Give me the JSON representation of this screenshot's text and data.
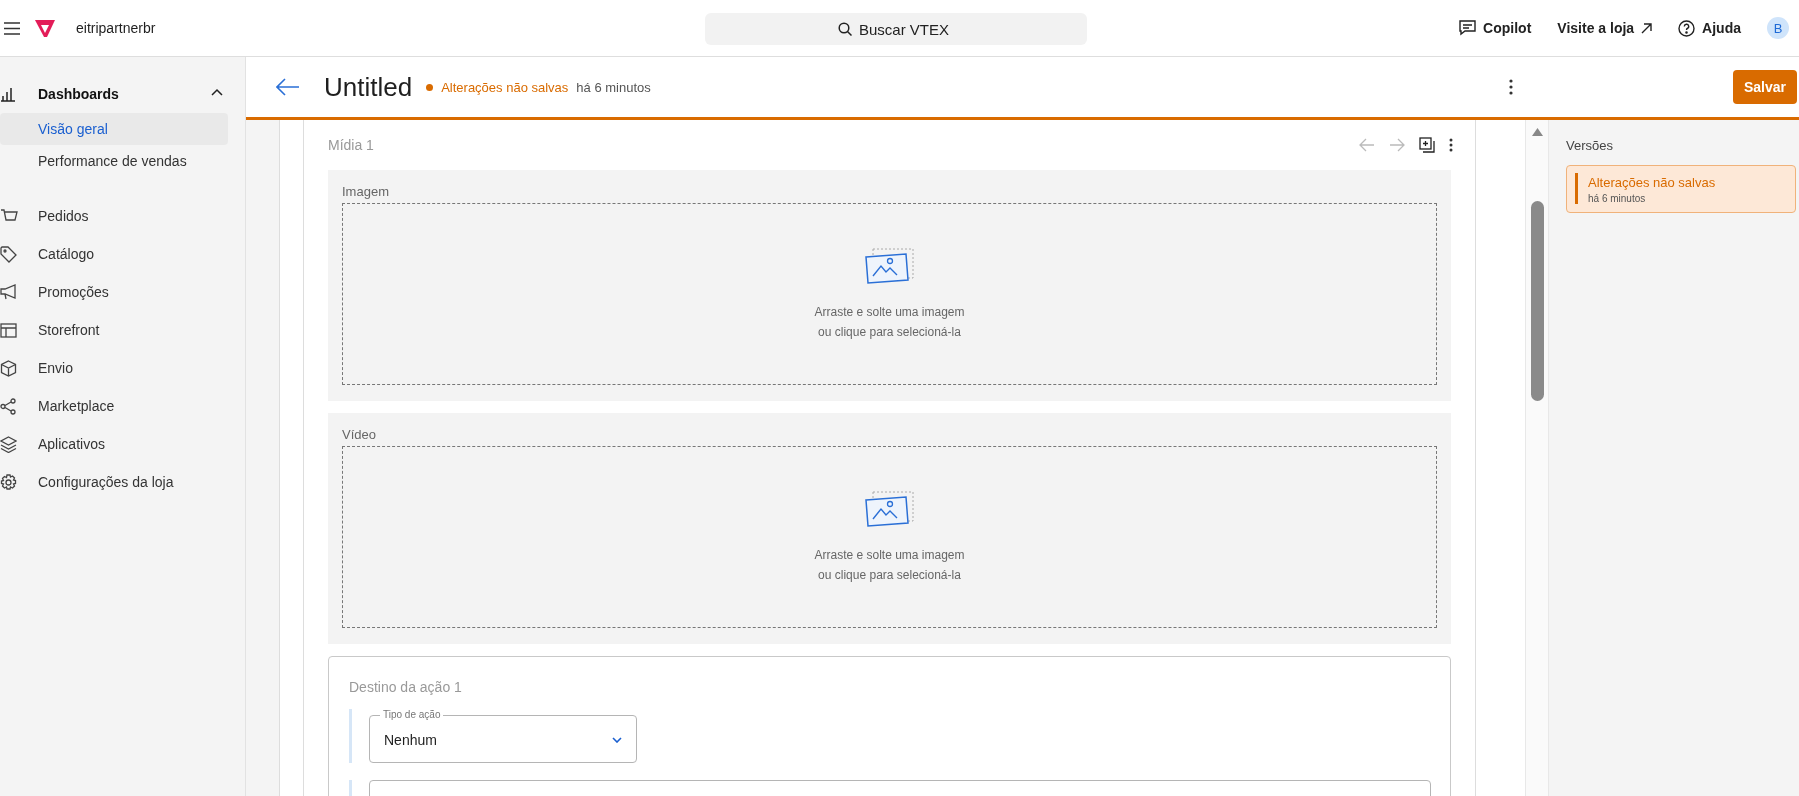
{
  "topbar": {
    "account": "eitripartnerbr",
    "search": {
      "placeholder": "Buscar VTEX"
    },
    "links": [
      {
        "label": "Copilot",
        "kind": "chat"
      },
      {
        "label": "Visite a loja",
        "kind": "external"
      },
      {
        "label": "Ajuda",
        "kind": "help"
      }
    ],
    "avatar": "B"
  },
  "sidebar": {
    "items": [
      {
        "label": "Dashboards",
        "kind": "chart",
        "selected": false,
        "expanded": true,
        "children": [
          {
            "label": "Visão geral",
            "selected": true
          },
          {
            "label": "Performance de vendas",
            "selected": false
          }
        ]
      },
      {
        "label": "Pedidos",
        "kind": "cart",
        "selected": false
      },
      {
        "label": "Catálogo",
        "kind": "tag",
        "selected": false
      },
      {
        "label": "Promoções",
        "kind": "megaphone",
        "selected": false
      },
      {
        "label": "Storefront",
        "kind": "layout",
        "selected": false
      },
      {
        "label": "Envio",
        "kind": "box",
        "selected": false
      },
      {
        "label": "Marketplace",
        "kind": "share",
        "selected": false
      },
      {
        "label": "Aplicativos",
        "kind": "layers",
        "selected": false
      },
      {
        "label": "Configurações da loja",
        "kind": "gear",
        "selected": false
      }
    ]
  },
  "editor": {
    "title": "Untitled",
    "status": "Alterações não salvas",
    "time": "há 6 minutos",
    "save_button": "Salvar"
  },
  "media": {
    "title": "Mídia 1",
    "fields": [
      {
        "label": "Imagem",
        "hint_lines": [
          "Arraste e solte uma imagem",
          "ou clique para selecioná-la"
        ]
      },
      {
        "label": "Vídeo",
        "hint_lines": [
          "Arraste e solte uma imagem",
          "ou clique para selecioná-la"
        ]
      }
    ]
  },
  "action": {
    "title": "Destino da ação 1",
    "select": {
      "label": "Tipo de ação",
      "value": "Nenhum"
    }
  },
  "versions": {
    "title": "Versões",
    "items": [
      {
        "title": "Alterações não salvas",
        "time": "há 6 minutos",
        "selected": true
      }
    ]
  }
}
